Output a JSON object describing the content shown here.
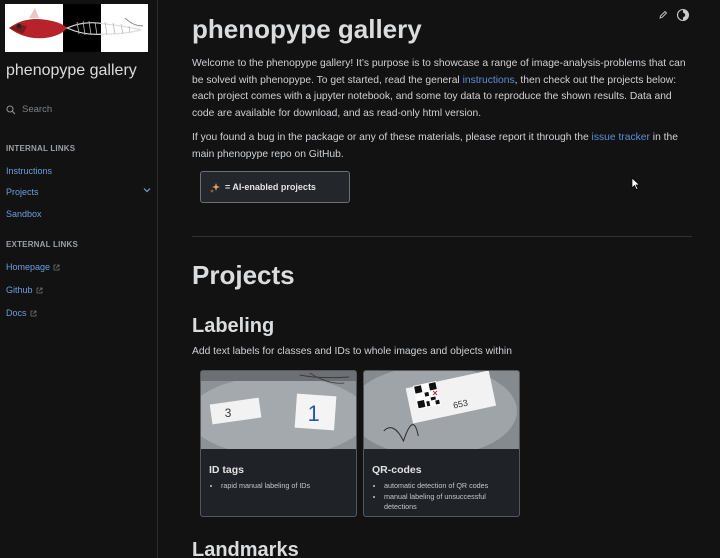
{
  "sidebar": {
    "title": "phenopype gallery",
    "search_placeholder": "Search",
    "internal_heading": "INTERNAL LINKS",
    "internal_links": [
      {
        "label": "Instructions"
      },
      {
        "label": "Projects"
      },
      {
        "label": "Sandbox"
      }
    ],
    "external_heading": "EXTERNAL LINKS",
    "external_links": [
      {
        "label": "Homepage"
      },
      {
        "label": "Github"
      },
      {
        "label": "Docs"
      }
    ]
  },
  "main": {
    "title": "phenopype gallery",
    "intro_1": "Welcome to the phenopype gallery! It’s purpose is to showcase a range of image-analysis-problems that can be solved with phenopype. To get started, read the general ",
    "intro_link": "instructions",
    "intro_2": ", then check out the projects below: each project comes with a jupyter notebook, and some toy data to reproduce the shown results. Data and code are available for download, and as read-only html version.",
    "bug_1": "If you found a bug in the package or any of these materials, please report it through the ",
    "bug_link": "issue tracker",
    "bug_2": " in the main phenopype repo on GitHub.",
    "ai_button": "= AI-enabled projects",
    "projects_heading": "Projects",
    "labeling_heading": "Labeling",
    "labeling_desc": "Add text labels for classes and IDs to whole images and objects within",
    "cards": [
      {
        "title": "ID tags",
        "bullets": [
          "rapid manual labeling of IDs"
        ]
      },
      {
        "title": "QR-codes",
        "bullets": [
          "automatic detection of QR codes",
          "manual labeling of unsuccessful detections"
        ]
      }
    ],
    "landmarks_heading": "Landmarks",
    "card1_tags": [
      "3",
      "1"
    ],
    "card2_tag": "653"
  }
}
